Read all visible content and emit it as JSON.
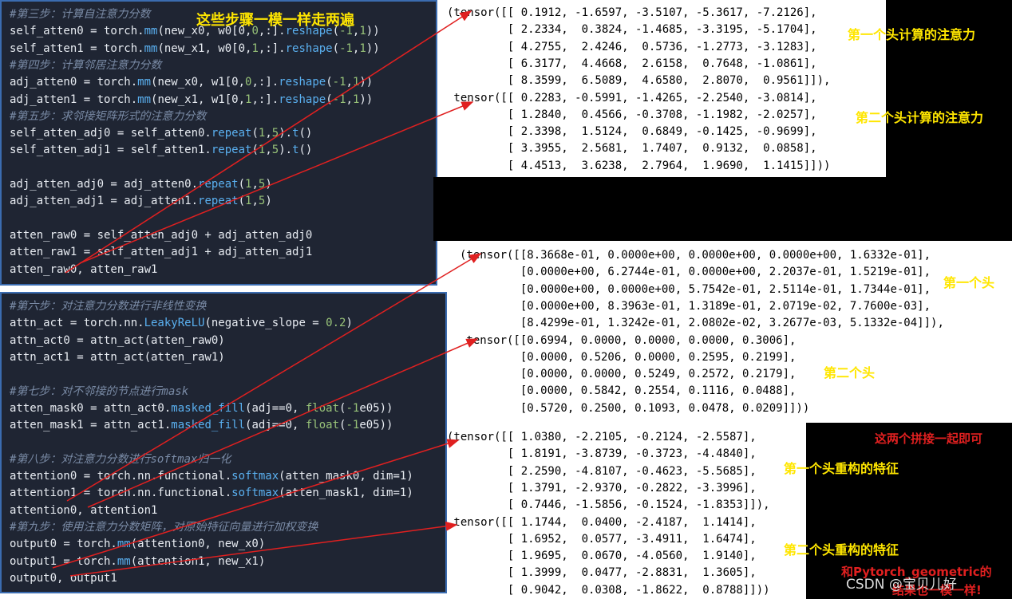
{
  "code_panel_1": {
    "lines": [
      {
        "t": "#第三步：计算自注意力分数",
        "k": "cm"
      },
      {
        "t": "self_atten0 = torch.mm(new_x0, w0[0,0,:].reshape(-1,1))",
        "k": "code"
      },
      {
        "t": "self_atten1 = torch.mm(new_x1, w0[0,1,:].reshape(-1,1))",
        "k": "code"
      },
      {
        "t": "#第四步：计算邻居注意力分数",
        "k": "cm"
      },
      {
        "t": "adj_atten0 = torch.mm(new_x0, w1[0,0,:].reshape(-1,1))",
        "k": "code"
      },
      {
        "t": "adj_atten1 = torch.mm(new_x1, w1[0,1,:].reshape(-1,1))",
        "k": "code"
      },
      {
        "t": "#第五步：求邻接矩阵形式的注意力分数",
        "k": "cm"
      },
      {
        "t": "self_atten_adj0 = self_atten0.repeat(1,5).t()",
        "k": "code"
      },
      {
        "t": "self_atten_adj1 = self_atten1.repeat(1,5).t()",
        "k": "code"
      },
      {
        "t": "",
        "k": "code"
      },
      {
        "t": "adj_atten_adj0 = adj_atten0.repeat(1,5)",
        "k": "code"
      },
      {
        "t": "adj_atten_adj1 = adj_atten1.repeat(1,5)",
        "k": "code"
      },
      {
        "t": "",
        "k": "code"
      },
      {
        "t": "atten_raw0 = self_atten_adj0 + adj_atten_adj0",
        "k": "code"
      },
      {
        "t": "atten_raw1 = self_atten_adj1 + adj_atten_adj1",
        "k": "code"
      },
      {
        "t": "atten_raw0, atten_raw1",
        "k": "code"
      }
    ]
  },
  "code_panel_2": {
    "lines": [
      {
        "t": "#第六步：对注意力分数进行非线性变换",
        "k": "cm"
      },
      {
        "t": "attn_act = torch.nn.LeakyReLU(negative_slope = 0.2)",
        "k": "code"
      },
      {
        "t": "attn_act0 = attn_act(atten_raw0)",
        "k": "code"
      },
      {
        "t": "attn_act1 = attn_act(atten_raw1)",
        "k": "code"
      },
      {
        "t": "",
        "k": "code"
      },
      {
        "t": "#第七步：对不邻接的节点进行mask",
        "k": "cm"
      },
      {
        "t": "atten_mask0 = attn_act0.masked_fill(adj==0, float(-1e05))",
        "k": "code"
      },
      {
        "t": "atten_mask1 = attn_act1.masked_fill(adj==0, float(-1e05))",
        "k": "code"
      },
      {
        "t": "",
        "k": "code"
      },
      {
        "t": "#第八步：对注意力分数进行softmax归一化",
        "k": "cm"
      },
      {
        "t": "attention0 = torch.nn.functional.softmax(atten_mask0, dim=1)",
        "k": "code"
      },
      {
        "t": "attention1 = torch.nn.functional.softmax(atten_mask1, dim=1)",
        "k": "code"
      },
      {
        "t": "attention0, attention1",
        "k": "code"
      },
      {
        "t": "#第九步：使用注意力分数矩阵，对原始特征向量进行加权变换",
        "k": "cm"
      },
      {
        "t": "output0 = torch.mm(attention0, new_x0)",
        "k": "code"
      },
      {
        "t": "output1 = torch.mm(attention1, new_x1)",
        "k": "code"
      },
      {
        "t": "output0, output1",
        "k": "code"
      }
    ]
  },
  "output_1": [
    "(tensor([[ 0.1912, -1.6597, -3.5107, -5.3617, -7.2126],",
    "         [ 2.2334,  0.3824, -1.4685, -3.3195, -5.1704],",
    "         [ 4.2755,  2.4246,  0.5736, -1.2773, -3.1283],",
    "         [ 6.3177,  4.4668,  2.6158,  0.7648, -1.0861],",
    "         [ 8.3599,  6.5089,  4.6580,  2.8070,  0.9561]]),",
    " tensor([[ 0.2283, -0.5991, -1.4265, -2.2540, -3.0814],",
    "         [ 1.2840,  0.4566, -0.3708, -1.1982, -2.0257],",
    "         [ 2.3398,  1.5124,  0.6849, -0.1425, -0.9699],",
    "         [ 3.3955,  2.5681,  1.7407,  0.9132,  0.0858],",
    "         [ 4.4513,  3.6238,  2.7964,  1.9690,  1.1415]]))"
  ],
  "output_2": [
    "(tensor([[8.3668e-01, 0.0000e+00, 0.0000e+00, 0.0000e+00, 1.6332e-01],",
    "         [0.0000e+00, 6.2744e-01, 0.0000e+00, 2.2037e-01, 1.5219e-01],",
    "         [0.0000e+00, 0.0000e+00, 5.7542e-01, 2.5114e-01, 1.7344e-01],",
    "         [0.0000e+00, 8.3963e-01, 1.3189e-01, 2.0719e-02, 7.7600e-03],",
    "         [8.4299e-01, 1.3242e-01, 2.0802e-02, 3.2677e-03, 5.1332e-04]]),",
    " tensor([[0.6994, 0.0000, 0.0000, 0.0000, 0.3006],",
    "         [0.0000, 0.5206, 0.0000, 0.2595, 0.2199],",
    "         [0.0000, 0.0000, 0.5249, 0.2572, 0.2179],",
    "         [0.0000, 0.5842, 0.2554, 0.1116, 0.0488],",
    "         [0.5720, 0.2500, 0.1093, 0.0478, 0.0209]]))"
  ],
  "output_3": [
    "(tensor([[ 1.0380, -2.2105, -0.2124, -2.5587],",
    "         [ 1.8191, -3.8739, -0.3723, -4.4840],",
    "         [ 2.2590, -4.8107, -0.4623, -5.5685],",
    "         [ 1.3791, -2.9370, -0.2822, -3.3996],",
    "         [ 0.7446, -1.5856, -0.1524, -1.8353]]),",
    " tensor([[ 1.1744,  0.0400, -2.4187,  1.1414],",
    "         [ 1.6952,  0.0577, -3.4911,  1.6474],",
    "         [ 1.9695,  0.0670, -4.0560,  1.9140],",
    "         [ 1.3999,  0.0477, -2.8831,  1.3605],",
    "         [ 0.9042,  0.0308, -1.8622,  0.8788]]))"
  ],
  "annotations": {
    "steps_same": "这些步骤一模一样走两遍",
    "head1_attention": "第一个头计算的注意力",
    "head2_attention": "第二个头计算的注意力",
    "head1": "第一个头",
    "head2": "第二个头",
    "concat": "这两个拼接一起即可",
    "head1_feature": "第一个头重构的特征",
    "head2_feature": "第二个头重构的特征",
    "same_result_1": "和Pytorch_geometric的",
    "same_result_2": "结果也一模一样!",
    "watermark": "CSDN @宝贝儿好"
  },
  "colors": {
    "code_bg": "#1f2533",
    "comment": "#7a8ba6",
    "yellow": "#ffe600",
    "red": "#e02020",
    "arrow": "#e02020"
  }
}
